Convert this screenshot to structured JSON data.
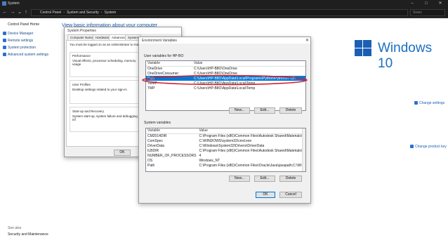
{
  "window": {
    "title": "System"
  },
  "address": {
    "crumbs": [
      "Control Panel",
      "System and Security",
      "System"
    ],
    "search_placeholder": "Searc"
  },
  "sidebar": {
    "home": "Control Panel Home",
    "items": [
      "Device Manager",
      "Remote settings",
      "System protection",
      "Advanced system settings"
    ],
    "see_also_label": "See also",
    "see_also_items": [
      "Security and Maintenance"
    ]
  },
  "main": {
    "heading": "View basic information about your computer",
    "brand": "Windows 10",
    "change_settings": "Change settings",
    "change_product_key": "Change product key"
  },
  "system_properties": {
    "title": "System Properties",
    "tabs": [
      "Computer Name",
      "Hardware",
      "Advanced",
      "System"
    ],
    "admin_note": "You must be logged on as an Administrator to make",
    "performance_title": "Performance",
    "performance_desc": "Visual effects, processor scheduling, memory usage",
    "profiles_title": "User Profiles",
    "profiles_desc": "Desktop settings related to your sign-in",
    "startup_title": "Start-up and Recovery",
    "startup_desc": "System start-up, system failure and debugging inf",
    "ok": "OK"
  },
  "env_vars": {
    "title": "Environment Variables",
    "user_group_label": "User variables for HP-BO",
    "col_variable": "Variable",
    "col_value": "Value",
    "user_vars": [
      {
        "name": "OneDrive",
        "value": "C:\\Users\\HP-B8O\\OneDrive"
      },
      {
        "name": "OneDriveConsumer",
        "value": "C:\\Users\\HP-B8O\\OneDrive"
      },
      {
        "name": "Path",
        "value": "C:\\Users\\HP-B8O\\AppData\\Local\\Programs\\Python\\Python37-32\\"
      },
      {
        "name": "TEMP",
        "value": "C:\\Users\\HP-B8O\\AppData\\Local\\Temp"
      },
      {
        "name": "TMP",
        "value": "C:\\Users\\HP-B8O\\AppData\\Local\\Temp"
      }
    ],
    "selected_index": 2,
    "system_group_label": "System variables",
    "system_vars": [
      {
        "name": "CM2014DIR",
        "value": "C:\\Program Files (x86)\\Common Files\\Autodesk Shared\\Materials\\"
      },
      {
        "name": "ComSpec",
        "value": "C:\\WINDOWS\\system32\\cmd.exe"
      },
      {
        "name": "DriverData",
        "value": "C:\\Windows\\System32\\Drivers\\DriverData"
      },
      {
        "name": "ILBDIR",
        "value": "C:\\Program Files (x86)\\Common Files\\Autodesk Shared\\Materials\\"
      },
      {
        "name": "NUMBER_OF_PROCESSORS",
        "value": "4"
      },
      {
        "name": "OS",
        "value": "Windows_NT"
      },
      {
        "name": "Path",
        "value": "C:\\Program Files (x86)\\Common Files\\Oracle\\Java\\javapath;C:\\WIN..."
      }
    ],
    "new_button": "New...",
    "edit_button": "Edit...",
    "delete_button": "Delete",
    "ok_button": "OK",
    "cancel_button": "Cancel"
  },
  "colors": {
    "accent": "#0078d7",
    "highlight_ring": "#d9202a",
    "brand": "#1a6fc0"
  }
}
